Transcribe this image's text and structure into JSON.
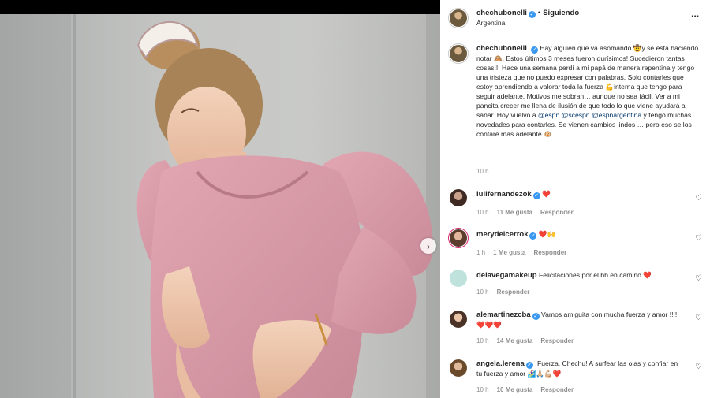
{
  "post": {
    "username": "chechubonelli",
    "follow_status": "Siguiendo",
    "location": "Argentina",
    "more_icon": "···",
    "next_icon": "›"
  },
  "caption": {
    "part1": "Hay alguien que va asomando 🤠y se está haciendo notar 🙈. Estos últimos 3 meses fueron durísimos! Sucedieron tantas cosas!!! Hace una semana perdí a mi papá de manera repentina y tengo una tristeza que no puedo expresar con palabras. Solo contarles que estoy aprendiendo a valorar toda la fuerza 💪interna que tengo para seguir adelante. Motivos me sobran… aunque no sea fácil. Ver a mi pancita crecer me llena de ilusión de que todo lo que viene ayudará a sanar. Hoy vuelvo a ",
    "mention1": "@espn",
    "mention2": "@scespn",
    "mention3": "@espnargentina",
    "part2": " y tengo muchas novedades para contarles. Se vienen cambios lindos … pero eso se los contaré mas adelante 🐵",
    "time": "10 h"
  },
  "comments": [
    {
      "user": "lulifernandezok",
      "text": "❤️",
      "time": "10 h",
      "likes": "11 Me gusta",
      "reply": "Responder",
      "verified": true
    },
    {
      "user": "merydelcerrok",
      "text": "❤️🙌",
      "time": "1 h",
      "likes": "1 Me gusta",
      "reply": "Responder",
      "verified": true
    },
    {
      "user": "delavegamakeup",
      "text": "Felicitaciones por el bb en camino ❤️",
      "time": "10 h",
      "likes": "",
      "reply": "Responder",
      "verified": false
    },
    {
      "user": "alemartinezcba",
      "text": "Vamos amiguita con mucha fuerza y amor !!!! ❤️❤️❤️",
      "time": "10 h",
      "likes": "14 Me gusta",
      "reply": "Responder",
      "verified": true
    },
    {
      "user": "angela.lerena",
      "text": "¡Fuerza, Chechu! A surfear las olas y confiar en tu fuerza y amor 🏄‍♀️🙏🏼💪🏼❤️",
      "time": "10 h",
      "likes": "10 Me gusta",
      "reply": "Responder",
      "verified": true
    }
  ],
  "colors": {
    "accent": "#3897f0",
    "heart_red": "#ed4956",
    "mention": "#00376b",
    "meta_gray": "#8e8e8e"
  }
}
